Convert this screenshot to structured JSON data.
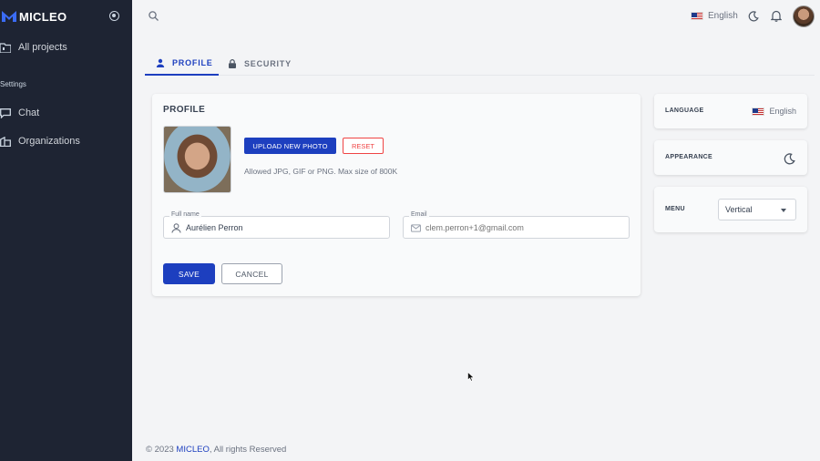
{
  "brand": {
    "name": "MICLEO",
    "accent": "#1d3fbf"
  },
  "sidebar": {
    "items": [
      {
        "label": "All projects",
        "icon": "folder-icon"
      },
      {
        "label": "Chat",
        "icon": "chat-icon"
      },
      {
        "label": "Organizations",
        "icon": "building-icon"
      }
    ],
    "section_label": "Settings"
  },
  "topbar": {
    "language": "English",
    "icons": [
      "search-icon",
      "flag-us-icon",
      "moon-icon",
      "bell-icon",
      "avatar"
    ]
  },
  "tabs": [
    {
      "label": "PROFILE",
      "icon": "user-icon",
      "active": true
    },
    {
      "label": "SECURITY",
      "icon": "lock-icon",
      "active": false
    }
  ],
  "profile": {
    "title": "PROFILE",
    "upload_label": "UPLOAD NEW PHOTO",
    "reset_label": "RESET",
    "hint": "Allowed JPG, GIF or PNG. Max size of 800K",
    "full_name_label": "Full name",
    "full_name_value": "Aurélien Perron",
    "email_label": "Email",
    "email_placeholder": "clem.perron+1@gmail.com",
    "save_label": "SAVE",
    "cancel_label": "CANCEL"
  },
  "settings_panel": {
    "language_label": "LANGUAGE",
    "language_value": "English",
    "appearance_label": "APPEARANCE",
    "menu_label": "MENU",
    "menu_value": "Vertical"
  },
  "footer": {
    "prefix": "© 2023 ",
    "link": "MICLEO",
    "suffix": ", All rights Reserved"
  }
}
